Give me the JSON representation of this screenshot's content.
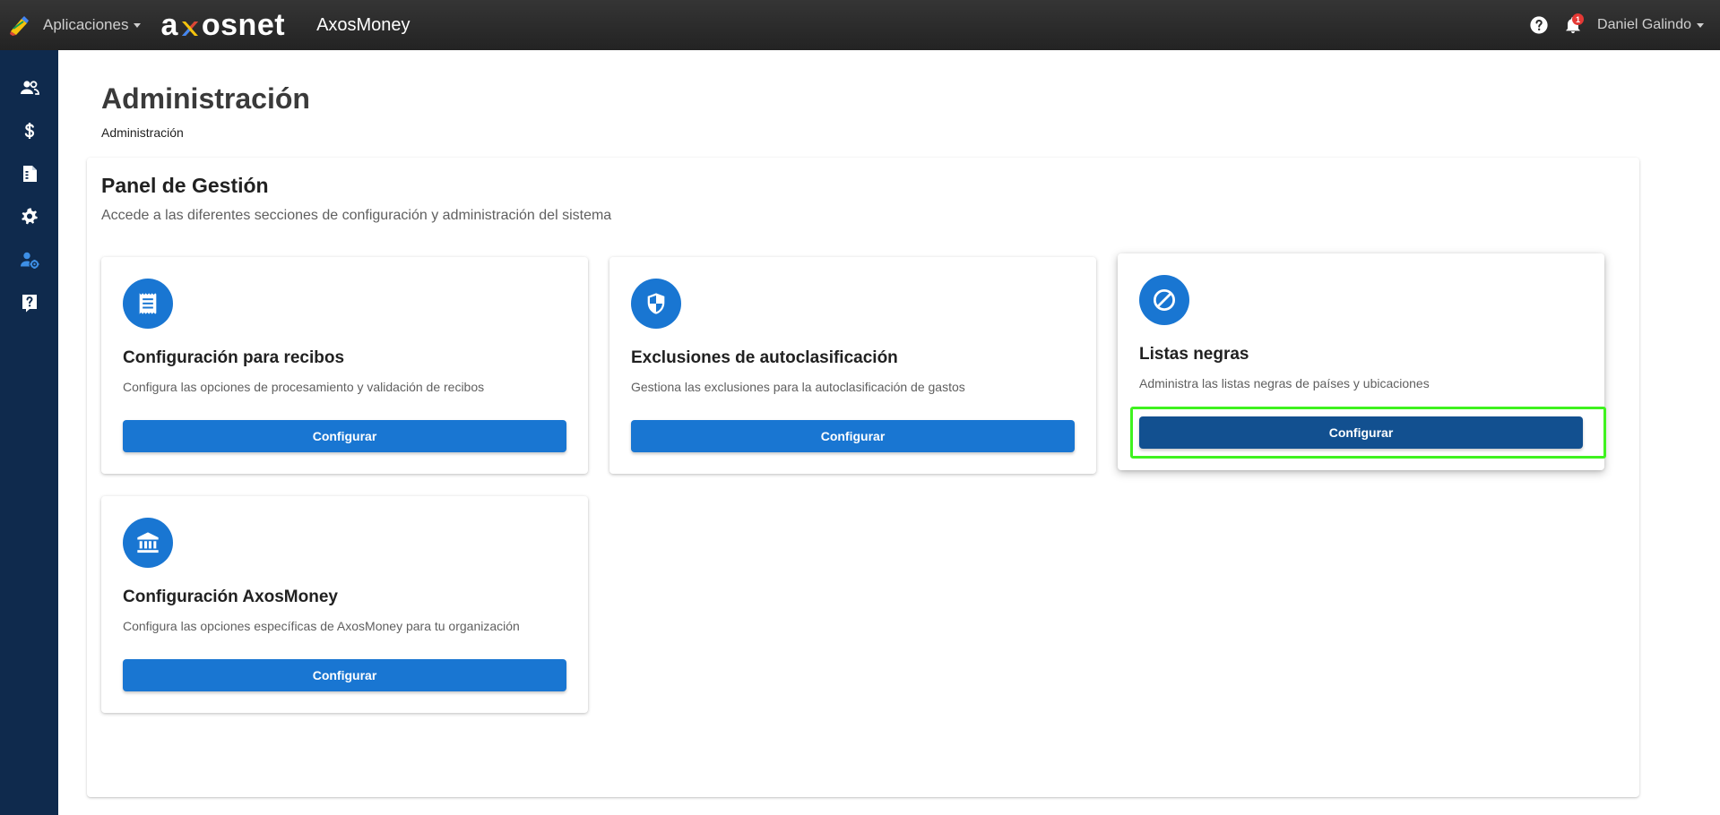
{
  "topbar": {
    "apps_label": "Aplicaciones",
    "brand_prefix": "a",
    "brand_suffix": "osnet",
    "app_name": "AxosMoney",
    "notification_count": "1",
    "user_name": "Daniel Galindo"
  },
  "sidebar": {
    "items": [
      {
        "icon": "users-icon"
      },
      {
        "icon": "dollar-icon"
      },
      {
        "icon": "receipt-icon"
      },
      {
        "icon": "gear-icon"
      },
      {
        "icon": "user-settings-icon",
        "active": true
      },
      {
        "icon": "help-book-icon"
      }
    ]
  },
  "page": {
    "title": "Administración",
    "breadcrumb": "Administración"
  },
  "panel": {
    "title": "Panel de Gestión",
    "subtitle": "Accede a las diferentes secciones de configuración y administración del sistema",
    "cards": [
      {
        "icon": "receipt-icon",
        "title": "Configuración para recibos",
        "description": "Configura las opciones de procesamiento y validación de recibos",
        "button": "Configurar"
      },
      {
        "icon": "shield-icon",
        "title": "Exclusiones de autoclasificación",
        "description": "Gestiona las exclusiones para la autoclasificación de gastos",
        "button": "Configurar"
      },
      {
        "icon": "block-icon",
        "title": "Listas negras",
        "description": "Administra las listas negras de países y ubicaciones",
        "button": "Configurar"
      },
      {
        "icon": "bank-icon",
        "title": "Configuración AxosMoney",
        "description": "Configura las opciones específicas de AxosMoney para tu organización",
        "button": "Configurar"
      }
    ]
  },
  "colors": {
    "topbar": "#2b2b2b",
    "sidebar": "#0f2a4d",
    "primary": "#1976d2",
    "button_active": "#125090",
    "highlight": "#3ff21f"
  }
}
